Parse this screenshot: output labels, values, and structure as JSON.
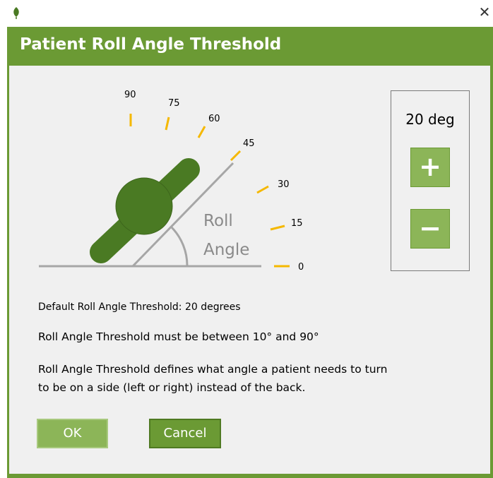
{
  "window": {
    "close_glyph": "✕",
    "app_icon": "leaf-icon"
  },
  "header": {
    "title": "Patient Roll Angle Threshold"
  },
  "diagram": {
    "tick_labels": [
      "90",
      "75",
      "60",
      "45",
      "30",
      "15",
      "0"
    ],
    "tick_values": [
      90,
      75,
      60,
      45,
      30,
      15,
      0
    ],
    "angle_label_line1": "Roll",
    "angle_label_line2": "Angle"
  },
  "threshold": {
    "value_text": "20 deg",
    "value": 20,
    "increment_label": "+",
    "decrement_label": "−"
  },
  "info": {
    "default_text": "Default Roll Angle Threshold: 20 degrees",
    "range_text": "Roll Angle Threshold must be between 10° and 90°",
    "description_line1": "Roll Angle Threshold defines what angle a patient needs to turn",
    "description_line2": "to be on a side (left or right) instead of the back."
  },
  "buttons": {
    "ok_label": "OK",
    "cancel_label": "Cancel"
  },
  "colors": {
    "brand_green": "#6b9a34",
    "button_light_green": "#8cb558",
    "patient_dark_green": "#4a7a23",
    "tick_orange": "#f5b800",
    "line_gray": "#a6a6a6"
  }
}
